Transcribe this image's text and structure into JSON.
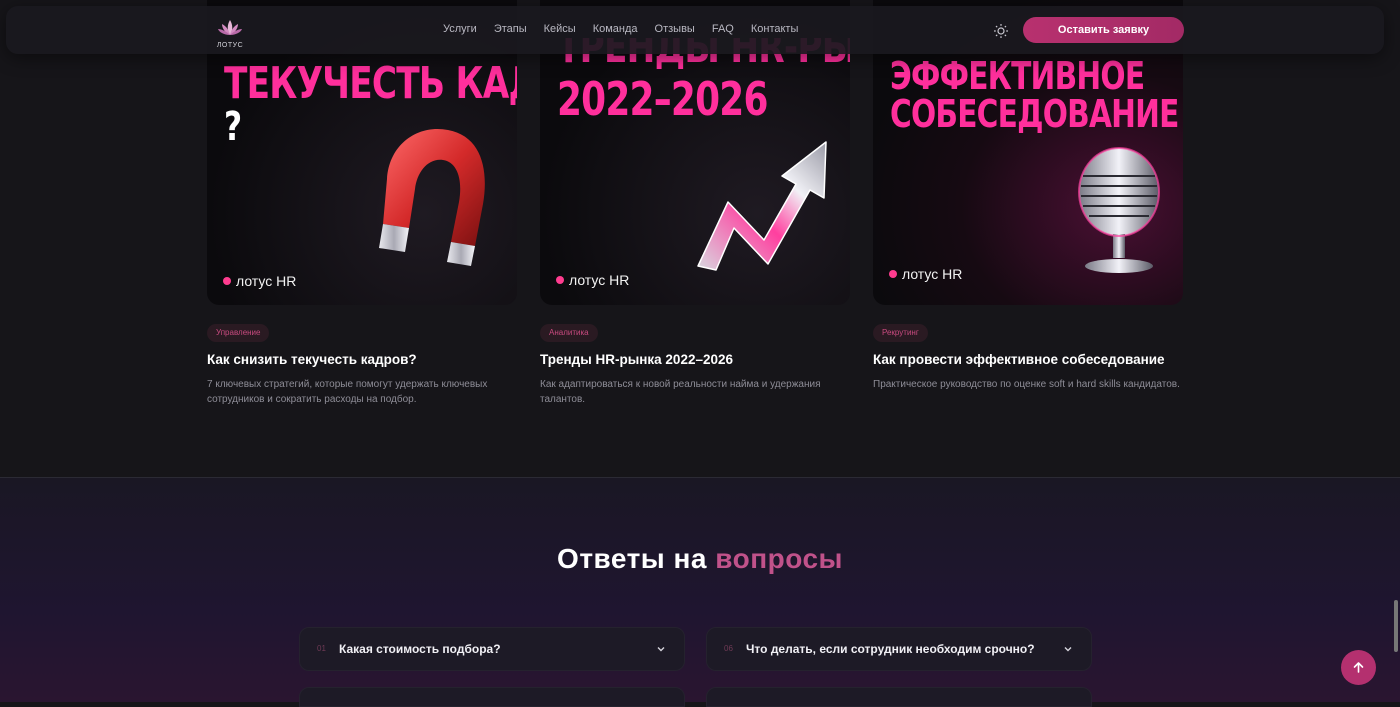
{
  "brand": {
    "logo_text": "ЛОТУС"
  },
  "nav": [
    "Услуги",
    "Этапы",
    "Кейсы",
    "Команда",
    "Отзывы",
    "FAQ",
    "Контакты"
  ],
  "header": {
    "cta_label": "Оставить заявку"
  },
  "cards": [
    {
      "poster_lines": [
        "ТЕКУЧЕСТЬ КАДРОВ",
        "?"
      ],
      "poster_brand": "лотус HR",
      "tag": "Управление",
      "title": "Как снизить текучесть кадров?",
      "desc": "7 ключевых стратегий, которые помогут удержать ключевых сотрудников и сократить расходы на подбор."
    },
    {
      "poster_lines": [
        "ТРЕНДЫ HR-РЫНКА",
        "2022–2026"
      ],
      "poster_brand": "лотус HR",
      "tag": "Аналитика",
      "title": "Тренды HR-рынка 2022–2026",
      "desc": "Как адаптироваться к новой реальности найма и удержания талантов."
    },
    {
      "poster_lines": [
        "ЭФФЕКТИВНОЕ",
        "СОБЕСЕДОВАНИЕ"
      ],
      "poster_brand": "лотус HR",
      "tag": "Рекрутинг",
      "title": "Как провести эффективное собеседование",
      "desc": "Практическое руководство по оценке soft и hard skills кандидатов."
    }
  ],
  "faq": {
    "heading_main": "Ответы на ",
    "heading_accent": "вопросы",
    "items": [
      {
        "num": "01",
        "question": "Какая стоимость подбора?"
      },
      {
        "num": "06",
        "question": "Что делать, если сотрудник необходим срочно?"
      }
    ]
  },
  "colors": {
    "accent": "#b4306f",
    "poster_pink": "#ff2f9c",
    "background": "#161519"
  }
}
